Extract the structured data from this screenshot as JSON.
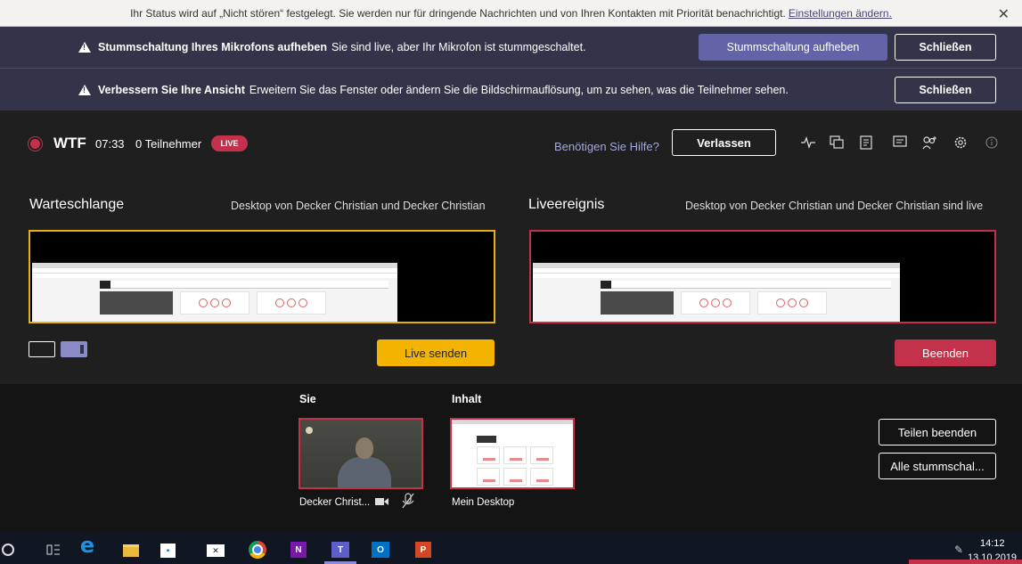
{
  "status_bar": {
    "text": "Ihr Status wird auf „Nicht stören“ festgelegt. Sie werden nur für dringende Nachrichten und von Ihren Kontakten mit Priorität benachrichtigt.",
    "link": "Einstellungen ändern.",
    "close": "✕"
  },
  "notifications": [
    {
      "title": "Stummschaltung Ihres Mikrofons aufheben",
      "text": "Sie sind live, aber Ihr Mikrofon ist stummgeschaltet.",
      "action": "Stummschaltung aufheben",
      "close": "Schließen"
    },
    {
      "title": "Verbessern Sie Ihre Ansicht",
      "text": "Erweitern Sie das Fenster oder ändern Sie die Bildschirmauflösung, um zu sehen, was die Teilnehmer sehen.",
      "close": "Schließen"
    }
  ],
  "meeting": {
    "title": "WTF",
    "time": "07:33",
    "participants": "0 Teilnehmer",
    "live_badge": "LIVE",
    "help": "Benötigen Sie Hilfe?",
    "leave": "Verlassen",
    "toolbar_icons": [
      "health-icon",
      "qa-icon",
      "notes-icon",
      "chat-icon",
      "people-icon",
      "settings-icon",
      "info-icon"
    ]
  },
  "queue": {
    "title": "Warteschlange",
    "subtitle": "Desktop von Decker Christian und Decker Christian",
    "go_live": "Live senden"
  },
  "live_event": {
    "title": "Liveereignis",
    "subtitle": "Desktop von Decker Christian und Decker Christian sind live",
    "end": "Beenden"
  },
  "tray": {
    "you_label": "Sie",
    "content_label": "Inhalt",
    "camera_name": "Decker Christ...",
    "content_name": "Mein Desktop",
    "stop_sharing": "Teilen beenden",
    "mute_all": "Alle stummschal..."
  },
  "taskbar": {
    "time": "14:12",
    "date": "13.10.2019",
    "apps": [
      "search-icon",
      "task-view-icon",
      "edge-icon",
      "file-explorer-icon",
      "store-icon",
      "mail-icon",
      "chrome-icon",
      "onenote-icon",
      "teams-icon",
      "outlook-icon",
      "powerpoint-icon"
    ]
  },
  "colors": {
    "accent": "#6264a7",
    "banner": "#33344a",
    "live": "#c4314b",
    "queue_border": "#e6b116",
    "go_live": "#f2b400"
  }
}
